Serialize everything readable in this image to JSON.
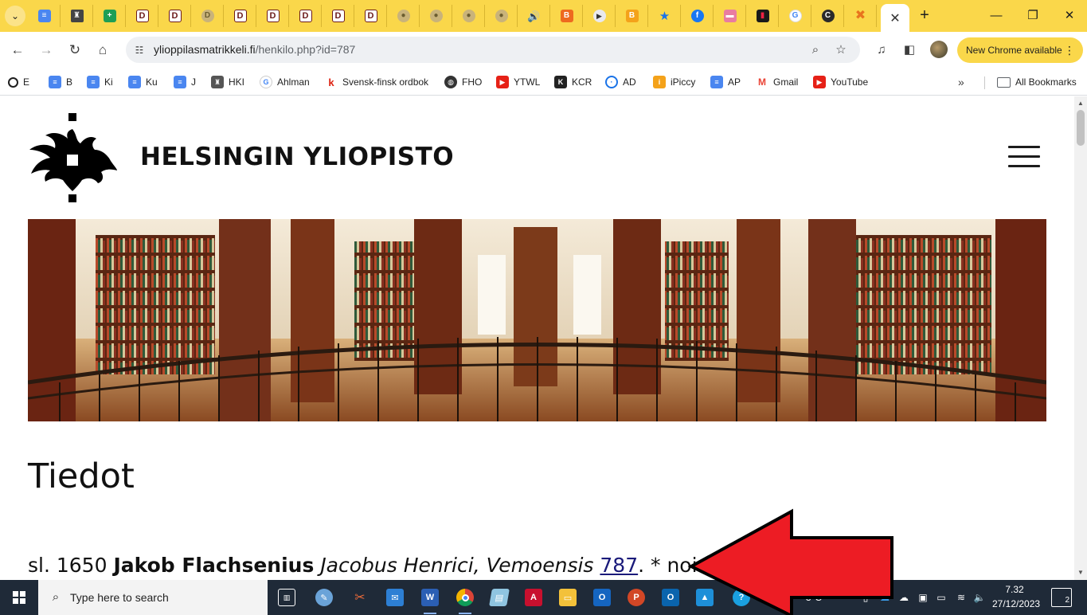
{
  "browser": {
    "url_host": "ylioppilasmatrikkeli.fi",
    "url_path": "/henkilo.php?id=787",
    "update_label": "New Chrome available",
    "tab_count_icons": [
      "doc",
      "crest",
      "sheet",
      "d",
      "d",
      "coin-d",
      "d",
      "d",
      "d",
      "d",
      "d",
      "coin",
      "coin",
      "coin",
      "coin",
      "speaker",
      "blogger",
      "play",
      "blogger",
      "star",
      "facebook",
      "pink",
      "black",
      "google",
      "c",
      "x"
    ]
  },
  "bookmarks": [
    {
      "label": "E",
      "icon": "outline-circle-icon"
    },
    {
      "label": "B",
      "icon": "doc-icon"
    },
    {
      "label": "Ki",
      "icon": "doc-icon"
    },
    {
      "label": "Ku",
      "icon": "doc-icon"
    },
    {
      "label": "J",
      "icon": "doc-icon"
    },
    {
      "label": "HKI",
      "icon": "crest-icon"
    },
    {
      "label": "Ahlman",
      "icon": "google-icon"
    },
    {
      "label": "Svensk-finsk ordbok",
      "icon": "k-icon"
    },
    {
      "label": "FHO",
      "icon": "globe-icon"
    },
    {
      "label": "YTWL",
      "icon": "youtube-icon"
    },
    {
      "label": "KCR",
      "icon": "kcr-icon"
    },
    {
      "label": "AD",
      "icon": "ad-icon"
    },
    {
      "label": "iPiccy",
      "icon": "ipiccy-icon"
    },
    {
      "label": "AP",
      "icon": "doc-icon"
    },
    {
      "label": "Gmail",
      "icon": "gmail-icon"
    },
    {
      "label": "YouTube",
      "icon": "youtube-icon"
    }
  ],
  "all_bookmarks_label": "All Bookmarks",
  "site": {
    "name": "HELSINGIN YLIOPISTO",
    "page_title": "Tiedot"
  },
  "record": {
    "prefix": "sl. 1650 ",
    "name": "Jakob Flachsenius",
    "latin_name": "Jacobus Henrici, Vemoensis",
    "number": "787",
    "suffix": ". * noin"
  },
  "taskbar": {
    "search_placeholder": "Type here to search",
    "temperature": "-3°C",
    "time": "7.32",
    "date": "27/12/2023",
    "notifications": "2"
  },
  "colors": {
    "tabstrip": "#fad74a",
    "arrow": "#ed1c24",
    "taskbar": "#1f2a38"
  }
}
